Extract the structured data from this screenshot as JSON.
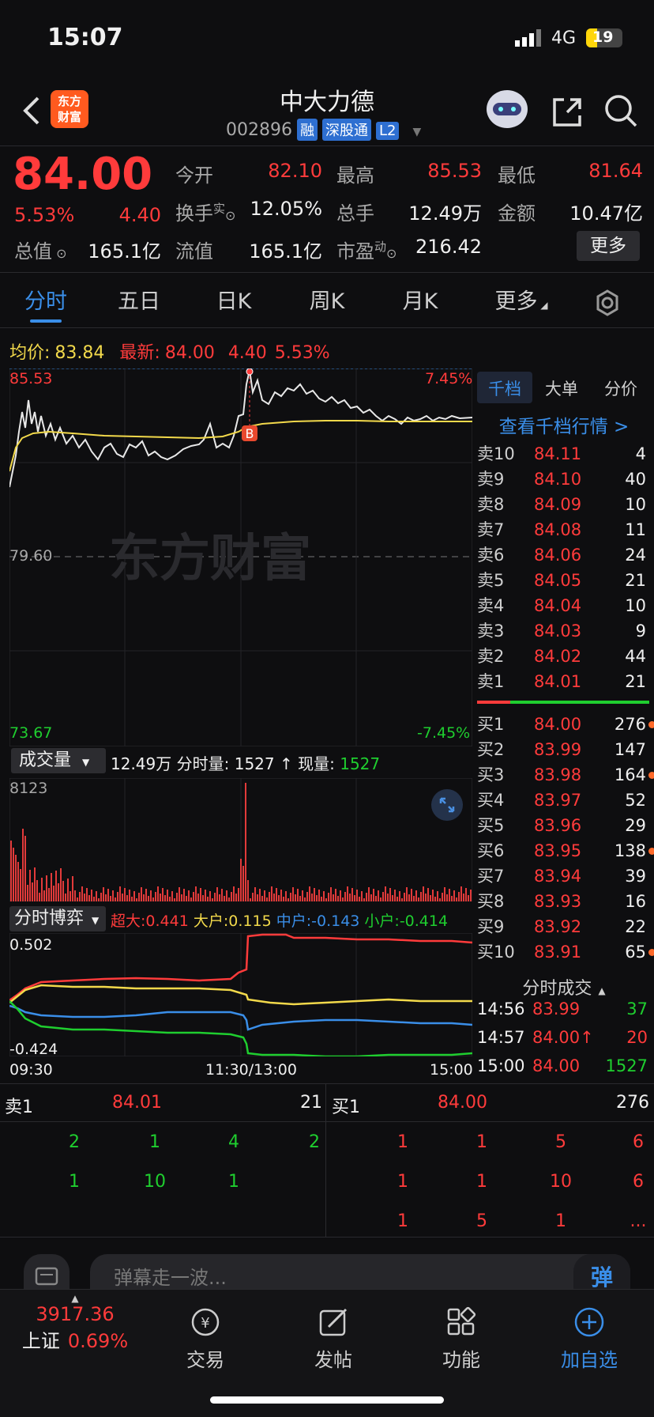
{
  "status": {
    "time": "15:07",
    "network": "4G",
    "battery": "19"
  },
  "header": {
    "back": "<",
    "logo_line1": "东方",
    "logo_line2": "财富",
    "name": "中大力德",
    "code": "002896",
    "tags": [
      "融",
      "深股通",
      "L2"
    ]
  },
  "quote": {
    "price": "84.00",
    "pct": "5.53%",
    "chg": "4.40",
    "today_open_label": "今开",
    "today_open": "82.10",
    "high_label": "最高",
    "high": "85.53",
    "low_label": "最低",
    "low": "81.64",
    "turnover_label": "换手",
    "turnover_sup": "实",
    "turnover": "12.05%",
    "volume_label": "总手",
    "volume": "12.49万",
    "amount_label": "金额",
    "amount": "10.47亿",
    "mktcap_label": "总值",
    "mktcap": "165.1亿",
    "float_label": "流值",
    "float": "165.1亿",
    "pe_label": "市盈",
    "pe_sup": "动",
    "pe": "216.42",
    "more_button": "更多"
  },
  "tabs": [
    {
      "label": "分时"
    },
    {
      "label": "五日"
    },
    {
      "label": "日K"
    },
    {
      "label": "周K"
    },
    {
      "label": "月K"
    },
    {
      "label": "更多"
    }
  ],
  "summary": {
    "avg_label": "均价:",
    "avg": "83.84",
    "latest_label": "最新:",
    "latest": "84.00",
    "chg": "4.40",
    "pct": "5.53%"
  },
  "chart": {
    "high": "85.53",
    "high_pct": "7.45%",
    "mid": "79.60",
    "low": "73.67",
    "low_pct": "-7.45%",
    "watermark": "东方财富",
    "marker": "B"
  },
  "volume": {
    "selector": "成交量",
    "total": "12.49万",
    "fen_label": "分时量:",
    "fen": "1527",
    "arrow": "↑",
    "now_label": "现量:",
    "now": "1527",
    "max": "8123"
  },
  "game": {
    "selector": "分时博弈",
    "super_label": "超大:",
    "super": "0.441",
    "big_label": "大户:",
    "big": "0.115",
    "mid_label": "中户:",
    "mid": "-0.143",
    "small_label": "小户:",
    "small": "-0.414",
    "top": "0.502",
    "bottom": "-0.424"
  },
  "time_axis": {
    "start": "09:30",
    "middle": "11:30/13:00",
    "end": "15:00"
  },
  "orderbook": {
    "tabs": [
      "千档",
      "大单",
      "分价"
    ],
    "link": "查看千档行情 >",
    "asks": [
      {
        "label": "卖10",
        "price": "84.11",
        "vol": "4"
      },
      {
        "label": "卖9",
        "price": "84.10",
        "vol": "40"
      },
      {
        "label": "卖8",
        "price": "84.09",
        "vol": "10"
      },
      {
        "label": "卖7",
        "price": "84.08",
        "vol": "11"
      },
      {
        "label": "卖6",
        "price": "84.06",
        "vol": "24"
      },
      {
        "label": "卖5",
        "price": "84.05",
        "vol": "21"
      },
      {
        "label": "卖4",
        "price": "84.04",
        "vol": "10"
      },
      {
        "label": "卖3",
        "price": "84.03",
        "vol": "9"
      },
      {
        "label": "卖2",
        "price": "84.02",
        "vol": "44"
      },
      {
        "label": "卖1",
        "price": "84.01",
        "vol": "21"
      }
    ],
    "bids": [
      {
        "label": "买1",
        "price": "84.00",
        "vol": "276"
      },
      {
        "label": "买2",
        "price": "83.99",
        "vol": "147"
      },
      {
        "label": "买3",
        "price": "83.98",
        "vol": "164"
      },
      {
        "label": "买4",
        "price": "83.97",
        "vol": "52"
      },
      {
        "label": "买5",
        "price": "83.96",
        "vol": "29"
      },
      {
        "label": "买6",
        "price": "83.95",
        "vol": "138"
      },
      {
        "label": "买7",
        "price": "83.94",
        "vol": "39"
      },
      {
        "label": "买8",
        "price": "83.93",
        "vol": "16"
      },
      {
        "label": "买9",
        "price": "83.92",
        "vol": "22"
      },
      {
        "label": "买10",
        "price": "83.91",
        "vol": "65"
      }
    ]
  },
  "ticks": {
    "title": "分时成交",
    "rows": [
      {
        "time": "14:56",
        "price": "83.99",
        "vol": "37"
      },
      {
        "time": "14:57",
        "price": "84.00↑",
        "vol": "20"
      },
      {
        "time": "15:00",
        "price": "84.00",
        "vol": "1527"
      }
    ]
  },
  "queue": {
    "sell_label": "卖1",
    "sell_price": "84.01",
    "sell_vol": "21",
    "buy_label": "买1",
    "buy_price": "84.00",
    "buy_vol": "276",
    "sell_row1": [
      "2",
      "1",
      "4",
      "2"
    ],
    "sell_row2": [
      "1",
      "10",
      "1"
    ],
    "buy_row1": [
      "1",
      "1",
      "5",
      "6"
    ],
    "buy_row2": [
      "1",
      "1",
      "10",
      "6"
    ],
    "buy_row3": [
      "1",
      "5",
      "1",
      "..."
    ]
  },
  "danmu": {
    "placeholder": "弹幕走一波...",
    "button": "弹"
  },
  "bottom_nav": {
    "index_value": "3917.36",
    "index_name": "上证",
    "index_pct": "0.69%",
    "trade": "交易",
    "post": "发帖",
    "func": "功能",
    "add": "加自选"
  }
}
